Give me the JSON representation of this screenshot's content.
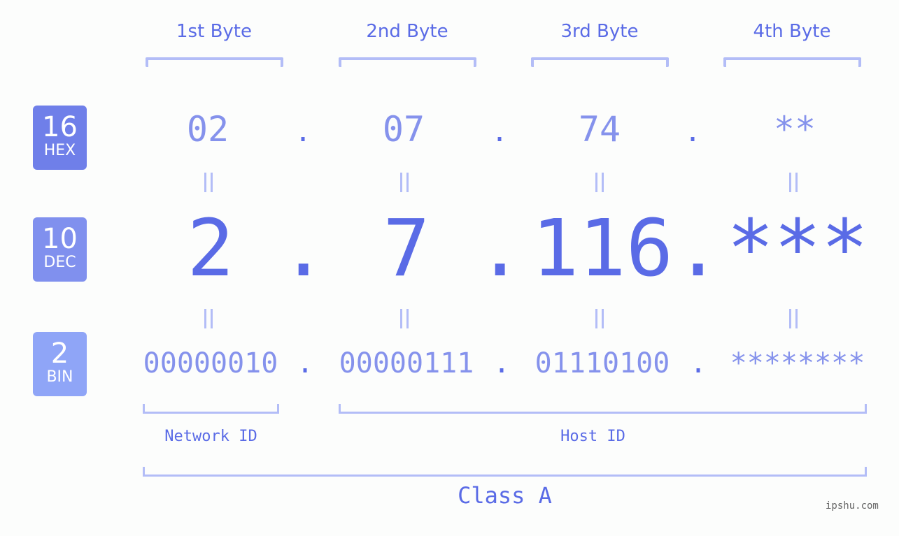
{
  "bytes": [
    {
      "label": "1st Byte",
      "hex": "02",
      "dec": "2",
      "bin": "00000010"
    },
    {
      "label": "2nd Byte",
      "hex": "07",
      "dec": "7",
      "bin": "00000111"
    },
    {
      "label": "3rd Byte",
      "hex": "74",
      "dec": "116",
      "bin": "01110100"
    },
    {
      "label": "4th Byte",
      "hex": "**",
      "dec": "***",
      "bin": "********"
    }
  ],
  "separator": ".",
  "badges": {
    "hex": {
      "num": "16",
      "label": "HEX",
      "color": "#6f7fe9"
    },
    "dec": {
      "num": "10",
      "label": "DEC",
      "color": "#8090ee"
    },
    "bin": {
      "num": "2",
      "label": "BIN",
      "color": "#8fa5f7"
    }
  },
  "network_id_label": "Network ID",
  "host_id_label": "Host ID",
  "class_label": "Class A",
  "watermark": "ipshu.com",
  "colors": {
    "accent": "#5a6be6",
    "light_value": "#8592ec",
    "bracket": "#b3bdf7",
    "background": "#fcfdfc"
  }
}
